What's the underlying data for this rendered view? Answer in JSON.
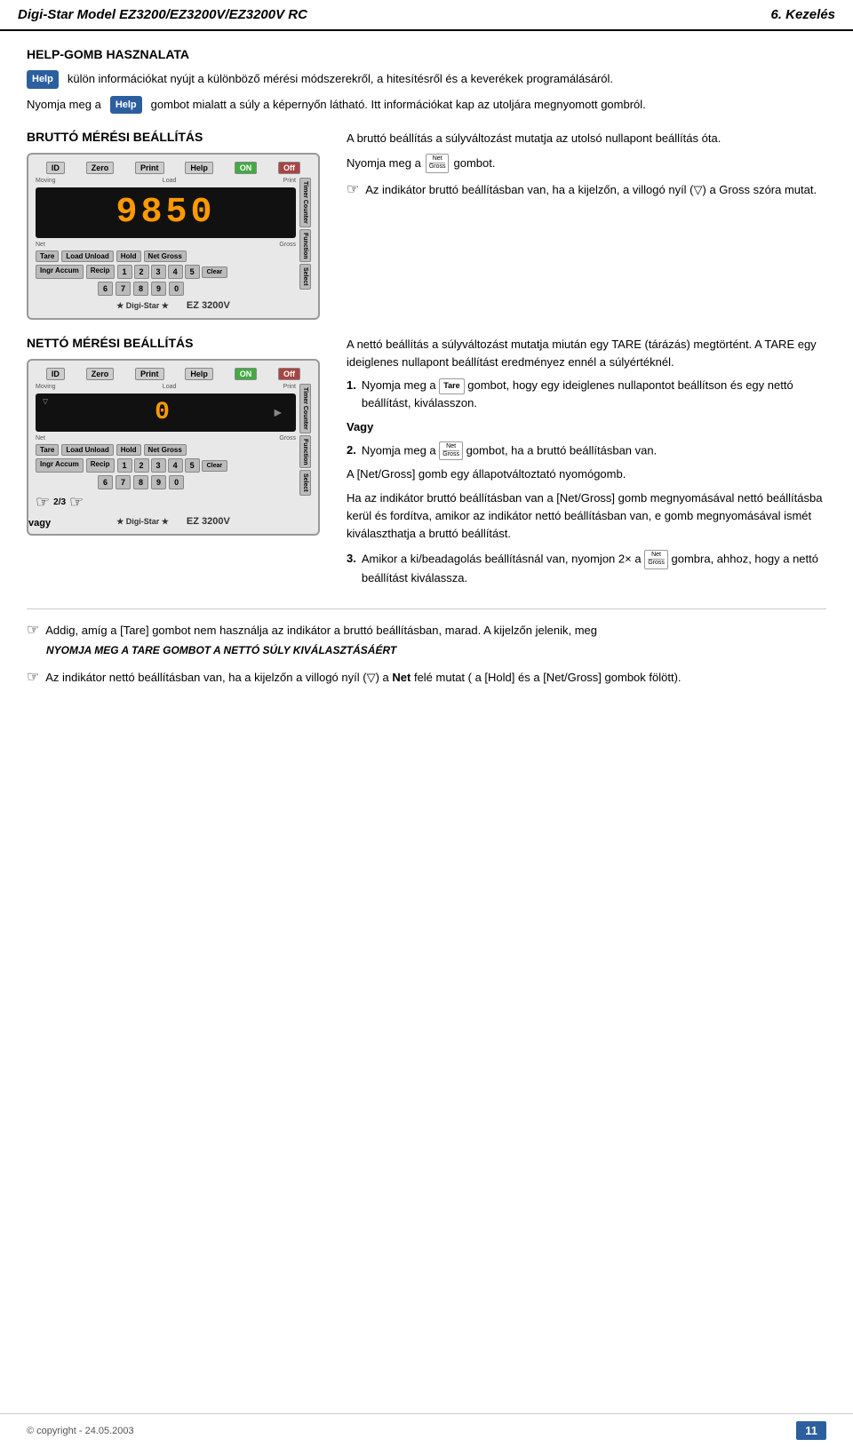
{
  "header": {
    "title": "Digi-Star Model EZ3200/EZ3200V/EZ3200V RC",
    "chapter": "6. Kezelés"
  },
  "section1": {
    "title": "HELP-GOMB HASZNALATA",
    "help_badge": "Help",
    "text1": "külön információkat nyújt a különböző mérési módszerekről, a hitesítésről és a keverékek programálásáról.",
    "text2_prefix": "Nyomja meg a",
    "text2_badge": "Help",
    "text2_suffix": "gombot mialatt a súly a képernyőn látható. Itt információkat kap az utoljára megnyomott gombról."
  },
  "section2": {
    "title": "BRUTTÓ MÉRÉSI BEÁLLÍTÁS",
    "display_value": "9850",
    "desc1": "A bruttó beállítás a súlyváltozást mutatja az utolsó nullapont beállítás óta.",
    "nyomja_text": "Nyomja meg a",
    "net_gross_label_top": "Net",
    "net_gross_label_bottom": "Gross",
    "gombot": "gombot.",
    "note_text": "Az indikátor bruttó beállításban van, ha a kijelzőn, a villogó nyíl (▽) a Gross szóra mutat."
  },
  "section3": {
    "title": "NETTÓ MÉRÉSI BEÁLLÍTÁS",
    "display_value": "0",
    "desc1": "A nettó beállítás a súlyváltozást mutatja miután egy TARE (tárázás) megtörtént. A TARE egy ideiglenes nullapont beállítást eredményez ennél a súlyértéknél.",
    "item1_num": "1.",
    "item1_text": "Nyomja meg a",
    "item1_tare": "Tare",
    "item1_text2": "gombot, hogy egy ideiglenes nullapontot beállítson és egy nettó beállítást, kiválasszon.",
    "vagy_label": "Vagy",
    "item2_num": "2.",
    "item2_text": "Nyomja meg a",
    "item2_ng_top": "Net",
    "item2_ng_bottom": "Gross",
    "item2_text2": "gombot, ha a bruttó beállításban van.",
    "net_gross_desc": "A [Net/Gross] gomb egy állapotváltoztató nyomógomb.",
    "net_gross_desc2": "Ha az indikátor bruttó beállításban van a [Net/Gross] gomb megnyomásával nettó beállításba kerül és fordítva, amikor az indikátor nettó beállításban van, e gomb megnyomásával ismét kiválaszthatja a bruttó beállítást.",
    "item3_num": "3.",
    "item3_text": "Amikor a ki/beadagolás beállításnál van, nyomjon 2× a",
    "item3_ng_top": "Net",
    "item3_ng_bottom": "Gross",
    "item3_text2": "gombra, ahhoz, hogy a nettó beállítást kiválassza."
  },
  "section4": {
    "memo1_prefix": "Addig, amíg a [Tare] gombot nem használja az indikátor a bruttó beállításban, marad. A kijelzőn jelenik, meg",
    "memo1_italic": "NYOMJA MEG A TARE GOMBOT A NETTÓ SÚLY KIVÁLASZTÁSÁÉRT",
    "memo2_prefix": "Az indikátor nettó beállításban van, ha a kijelzőn a villogó nyíl (▽) a",
    "memo2_bold": "Net",
    "memo2_suffix": "felé mutat ( a [Hold] és a [Net/Gross] gombok fölött)."
  },
  "footer": {
    "copyright": "© copyright - 24.05.2003",
    "page": "11"
  },
  "device": {
    "buttons_top": [
      "ID",
      "Zero",
      "Print",
      "Help",
      "ON",
      "Off"
    ],
    "labels_left": [
      "Moving",
      "Load"
    ],
    "labels_right": [
      "Print"
    ],
    "labels_mid": [
      "Net",
      "Gross"
    ],
    "side_btns": [
      "Timer Counter",
      "Function",
      "Select"
    ],
    "btns_left": [
      "Tare",
      "Load Unload",
      "Hold",
      "Net Gross",
      "Ingr Accum",
      "Recip"
    ],
    "num_row1": [
      "1",
      "2",
      "3",
      "4",
      "5",
      "Clear"
    ],
    "num_row2": [
      "6",
      "7",
      "8",
      "9",
      "0"
    ],
    "brand": "Digi-Star",
    "model": "EZ 3200V"
  }
}
